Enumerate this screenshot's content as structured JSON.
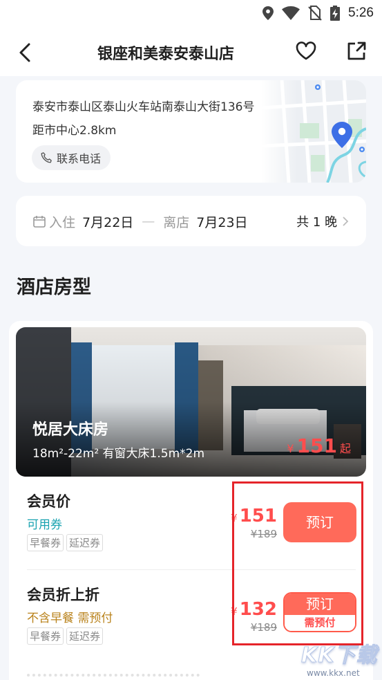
{
  "status_bar": {
    "time": "5:26",
    "icons": [
      "location-icon",
      "wifi-icon",
      "no-sim-icon",
      "battery-charging-icon"
    ]
  },
  "header": {
    "title": "银座和美泰安泰山店",
    "back_icon": "back-arrow-icon",
    "favorite_icon": "heart-icon",
    "share_icon": "share-icon"
  },
  "address_card": {
    "address": "泰安市泰山区泰山火车站南泰山大街136号",
    "distance": "距市中心2.8km",
    "phone_label": "联系电话",
    "phone_icon": "phone-icon"
  },
  "dates": {
    "checkin_label": "入住",
    "checkin_date": "7月22日",
    "separator": "—",
    "checkout_label": "离店",
    "checkout_date": "7月23日",
    "nights": "共 1 晚"
  },
  "section_title": "酒店房型",
  "room": {
    "name": "悦居大床房",
    "desc": "18m²-22m² 有窗大床1.5m*2m",
    "price_symbol": "¥",
    "price": "151",
    "price_suffix": "起"
  },
  "rates": [
    {
      "name": "会员价",
      "sub": "可用券",
      "tags": [
        "早餐券",
        "延迟券"
      ],
      "price_symbol": "¥",
      "price": "151",
      "original_price": "¥189",
      "book_label": "预订"
    },
    {
      "name": "会员折上折",
      "sub": "不含早餐 需预付",
      "tags": [
        "早餐券",
        "延迟券"
      ],
      "price_symbol": "¥",
      "price": "132",
      "original_price": "¥189",
      "book_label": "预订",
      "book_note": "需预付"
    }
  ],
  "watermark": {
    "title": "KK下载",
    "url": "www.kkx.net"
  },
  "colors": {
    "accent_red": "#ff6a5a",
    "price_red": "#ff4d4d",
    "teal": "#1aa3b0",
    "orange": "#b9821b",
    "highlight": "#e5242a"
  }
}
